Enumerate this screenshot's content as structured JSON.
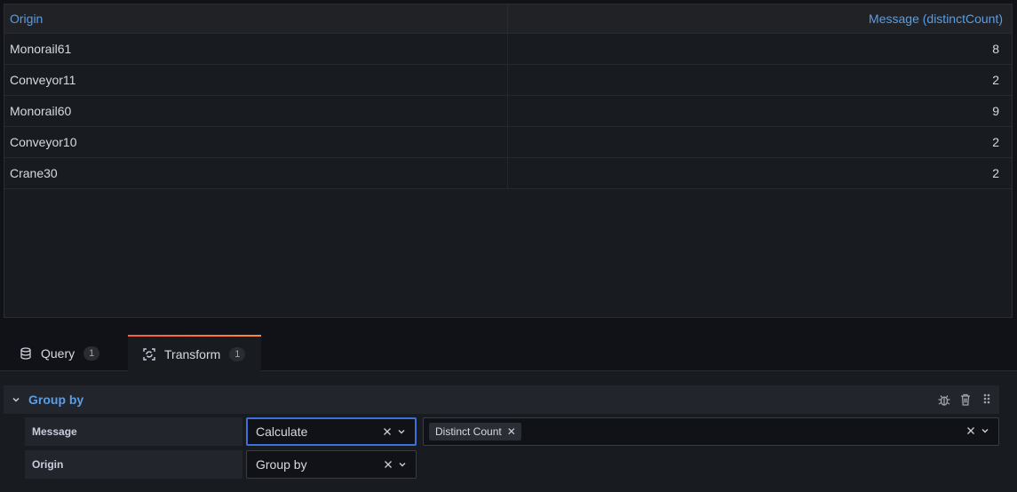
{
  "table": {
    "columns": [
      "Origin",
      "Message (distinctCount)"
    ],
    "rows": [
      {
        "origin": "Monorail61",
        "count": "8"
      },
      {
        "origin": "Conveyor11",
        "count": "2"
      },
      {
        "origin": "Monorail60",
        "count": "9"
      },
      {
        "origin": "Conveyor10",
        "count": "2"
      },
      {
        "origin": "Crane30",
        "count": "2"
      }
    ]
  },
  "tabs": [
    {
      "label": "Query",
      "count": "1",
      "icon": "database-icon"
    },
    {
      "label": "Transform",
      "count": "1",
      "icon": "transform-icon",
      "active": true
    }
  ],
  "transform": {
    "title": "Group by",
    "fields": [
      {
        "label": "Message",
        "mode": "Calculate",
        "calculations": [
          "Distinct Count"
        ]
      },
      {
        "label": "Origin",
        "mode": "Group by"
      }
    ]
  },
  "colors": {
    "accent": "#5a9ee6",
    "focus": "#3d71d9",
    "tab_active": "#f55f3e"
  }
}
